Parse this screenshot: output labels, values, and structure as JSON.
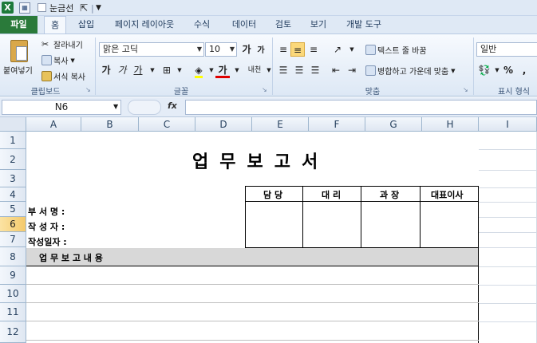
{
  "qat": {
    "gridlines_label": "눈금선"
  },
  "tabs": [
    {
      "label": "파일"
    },
    {
      "label": "홈"
    },
    {
      "label": "삽입"
    },
    {
      "label": "페이지 레이아웃"
    },
    {
      "label": "수식"
    },
    {
      "label": "데이터"
    },
    {
      "label": "검토"
    },
    {
      "label": "보기"
    },
    {
      "label": "개발 도구"
    }
  ],
  "ribbon": {
    "clipboard": {
      "paste": "붙여넣기",
      "cut": "잘라내기",
      "copy": "복사",
      "format_painter": "서식 복사",
      "label": "클립보드"
    },
    "font": {
      "name": "맑은 고딕",
      "size": "10",
      "grow": "가",
      "shrink": "가",
      "bold": "가",
      "italic": "가",
      "underline": "가",
      "font_color_glyph": "가",
      "phonetic": "내천",
      "label": "글꼴"
    },
    "alignment": {
      "wrap_text": "텍스트 줄 바꿈",
      "merge_center": "병합하고 가운데 맞춤",
      "label": "맞춤"
    },
    "number": {
      "format": "일반",
      "percent": "%",
      "comma": ",",
      "label": "표시 형식"
    }
  },
  "formula_bar": {
    "name_box": "N6",
    "fx": "fx",
    "value": ""
  },
  "grid": {
    "columns": [
      "A",
      "B",
      "C",
      "D",
      "E",
      "F",
      "G",
      "H",
      "I"
    ],
    "rows": [
      "1",
      "2",
      "3",
      "4",
      "5",
      "6",
      "7",
      "8",
      "9",
      "10",
      "11",
      "12"
    ],
    "selected_row": "6",
    "cells": {
      "title": "업무보고서",
      "approval_headers": [
        "담 당",
        "대 리",
        "과 장",
        "대표이사"
      ],
      "dept_label": "부 서 명 :",
      "author_label": "작 성 자 :",
      "date_label": "작성일자 :",
      "report_content_label": "업 무 보 고 내 용"
    }
  }
}
